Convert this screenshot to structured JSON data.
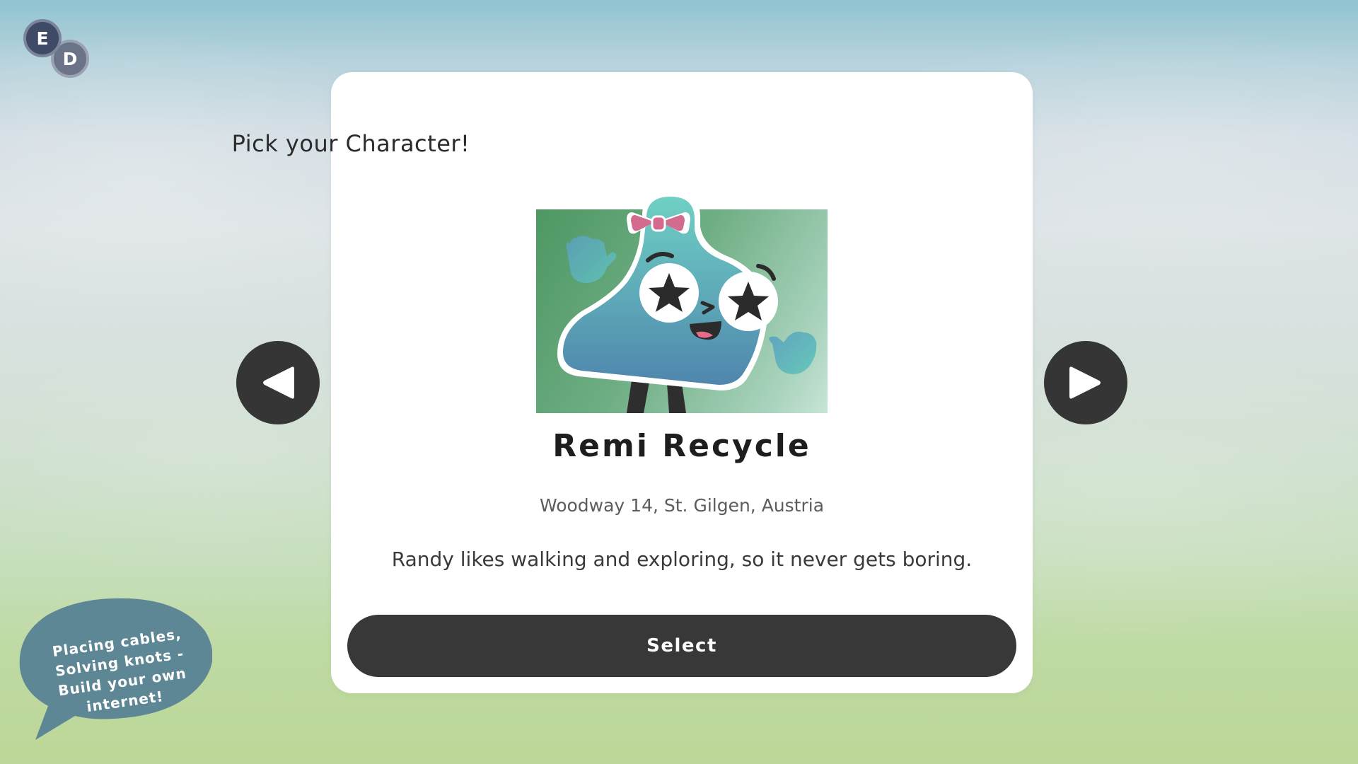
{
  "language_switcher": {
    "active": "E",
    "secondary": "D"
  },
  "card": {
    "title": "Pick your Character!",
    "character": {
      "name": "Remi Recycle",
      "address": "Woodway 14, St. Gilgen, Austria",
      "description": "Randy likes walking and exploring, so it never gets boring."
    },
    "select_label": "Select"
  },
  "navigation": {
    "prev_icon": "play-left-icon",
    "next_icon": "play-right-icon"
  },
  "speech_bubble": {
    "text": "Placing cables, Solving knots - Build your own internet!"
  },
  "colors": {
    "card_bg": "#ffffff",
    "button_dark": "#383838",
    "bubble": "#5e8796",
    "portrait_green": "#4e9763",
    "bow_pink": "#d26b8e",
    "character_teal": "#5fb7b4"
  }
}
